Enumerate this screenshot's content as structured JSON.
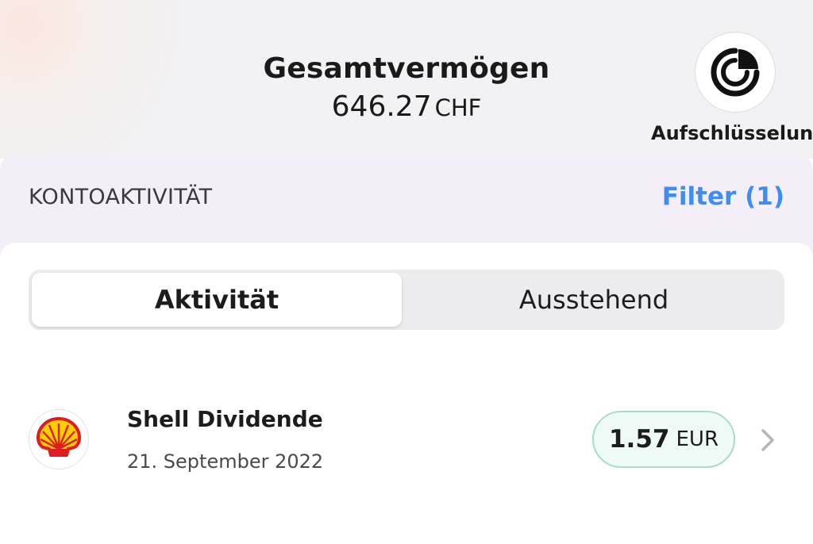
{
  "header": {
    "title": "Gesamtvermögen",
    "total_value": "646.27",
    "total_currency": "CHF",
    "breakdown_label": "Aufschlüsselung",
    "breakdown_icon": "pie-chart-icon"
  },
  "activity": {
    "section_title": "KONTOAKTIVITÄT",
    "filter_label": "Filter (1)",
    "accent_color": "#3d8ef0",
    "tabs": [
      {
        "label": "Aktivität",
        "selected": true
      },
      {
        "label": "Ausstehend",
        "selected": false
      }
    ],
    "items": [
      {
        "logo": "shell-logo-icon",
        "title": "Shell Dividende",
        "date": "21. September 2022",
        "amount": "1.57",
        "currency": "EUR",
        "amount_color": "#a7dccb"
      }
    ]
  }
}
